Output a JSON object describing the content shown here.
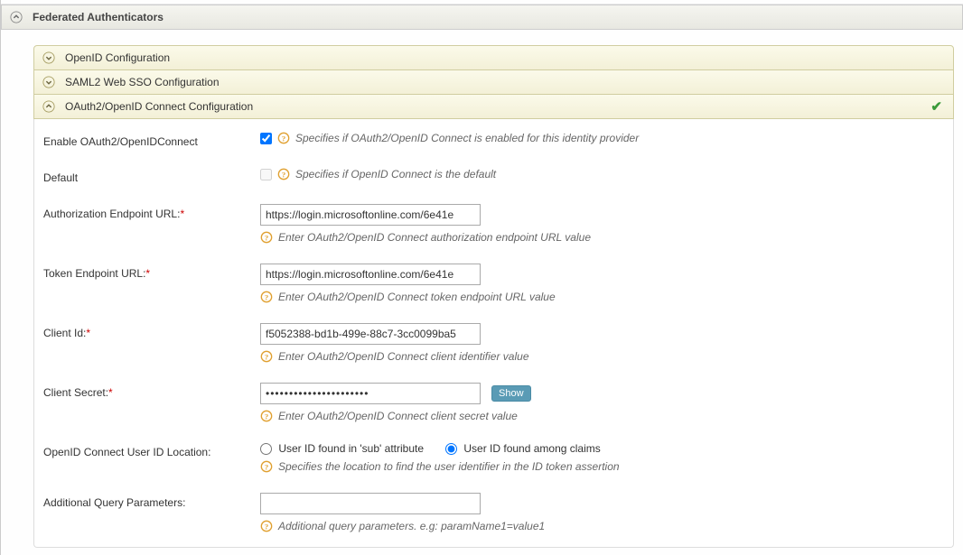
{
  "accordions": {
    "feds": "Federated Authenticators",
    "openid": "OpenID Configuration",
    "saml": "SAML2 Web SSO Configuration",
    "oauth": "OAuth2/OpenID Connect Configuration"
  },
  "fields": {
    "enable": {
      "label": "Enable OAuth2/OpenIDConnect",
      "help": "Specifies if OAuth2/OpenID Connect is enabled for this identity provider"
    },
    "default": {
      "label": "Default",
      "help": "Specifies if OpenID Connect is the default"
    },
    "authz": {
      "label": "Authorization Endpoint URL:",
      "value": "https://login.microsoftonline.com/6e41e",
      "help": "Enter OAuth2/OpenID Connect authorization endpoint URL value"
    },
    "token": {
      "label": "Token Endpoint URL:",
      "value": "https://login.microsoftonline.com/6e41e",
      "help": "Enter OAuth2/OpenID Connect token endpoint URL value"
    },
    "client_id": {
      "label": "Client Id:",
      "value": "f5052388-bd1b-499e-88c7-3cc0099ba5",
      "help": "Enter OAuth2/OpenID Connect client identifier value"
    },
    "client_secret": {
      "label": "Client Secret:",
      "value": "••••••••••••••••••••••",
      "show": "Show",
      "help": "Enter OAuth2/OpenID Connect client secret value"
    },
    "uid_loc": {
      "label": "OpenID Connect User ID Location:",
      "opt_sub": "User ID found in 'sub' attribute",
      "opt_claims": "User ID found among claims",
      "help": "Specifies the location to find the user identifier in the ID token assertion"
    },
    "addl": {
      "label": "Additional Query Parameters:",
      "value": "",
      "help": "Additional query parameters. e.g: paramName1=value1"
    }
  }
}
